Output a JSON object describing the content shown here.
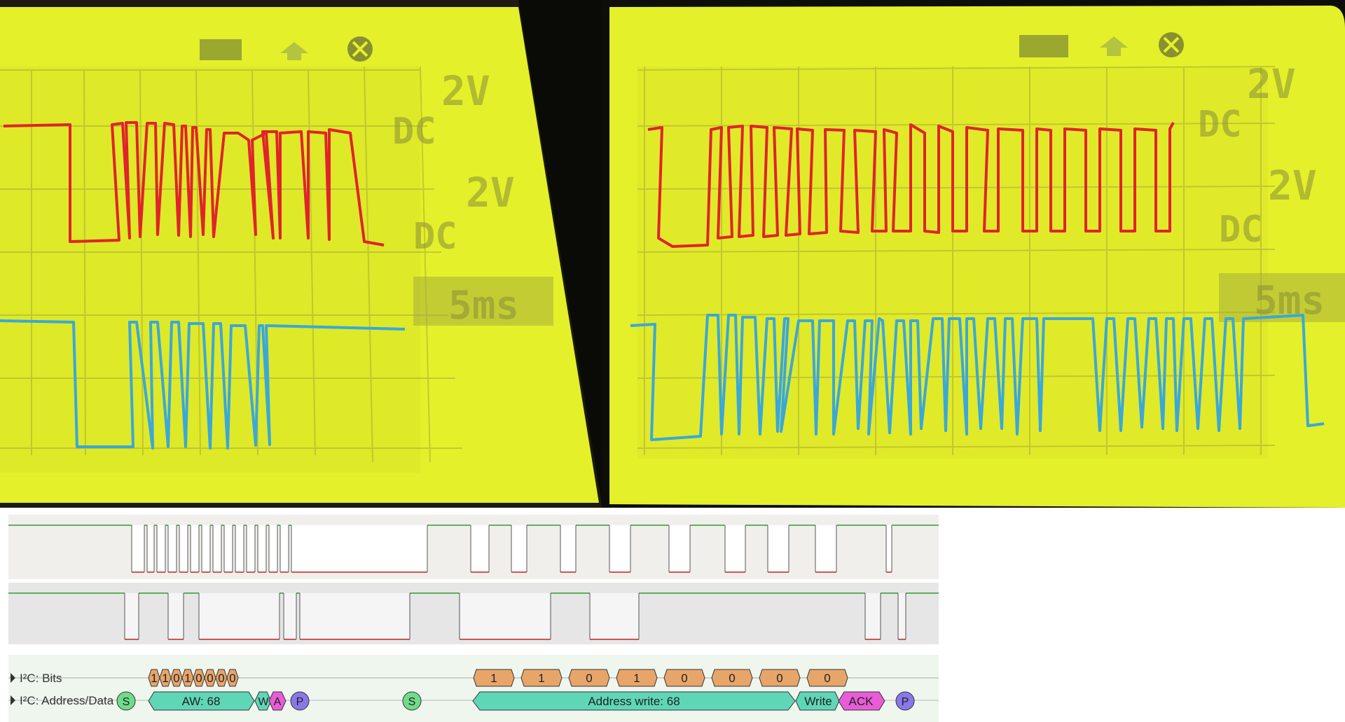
{
  "colors": {
    "lcd_background": "#e4f02a",
    "trace_red": "#e0242a",
    "trace_blue": "#3aa8d8",
    "bit_box": "#e8a56a",
    "address_box": "#5fd7b6",
    "start_marker": "#6fdc8c",
    "stop_marker": "#8878e8",
    "ack_box": "#e85cd8",
    "signal_high": "#2e9e2e",
    "signal_low": "#c42222"
  },
  "photos": {
    "left": {
      "labels": [
        "2V",
        "DC",
        "2V",
        "DC",
        "5ms"
      ],
      "icons": [
        "battery-icon",
        "trigger-arrow-icon",
        "run-stop-icon"
      ]
    },
    "right": {
      "labels": [
        "2V",
        "DC",
        "2V",
        "DC",
        "5ms"
      ],
      "icons": [
        "battery-icon",
        "trigger-arrow-icon",
        "run-stop-icon"
      ]
    }
  },
  "decoder": {
    "rows": [
      {
        "label": "I²C: Bits"
      },
      {
        "label": "I²C: Address/Data"
      }
    ],
    "group1": {
      "bits": [
        "1",
        "1",
        "0",
        "1",
        "0",
        "0",
        "0",
        "0"
      ],
      "start": "S",
      "address": "AW: 68",
      "write_marker": "W",
      "ack_marker": "A",
      "stop": "P"
    },
    "group2": {
      "start": "S",
      "bits": [
        "1",
        "1",
        "0",
        "1",
        "0",
        "0",
        "0",
        "0"
      ],
      "address": "Address write: 68",
      "write": "Write",
      "ack": "ACK",
      "stop": "P"
    }
  }
}
